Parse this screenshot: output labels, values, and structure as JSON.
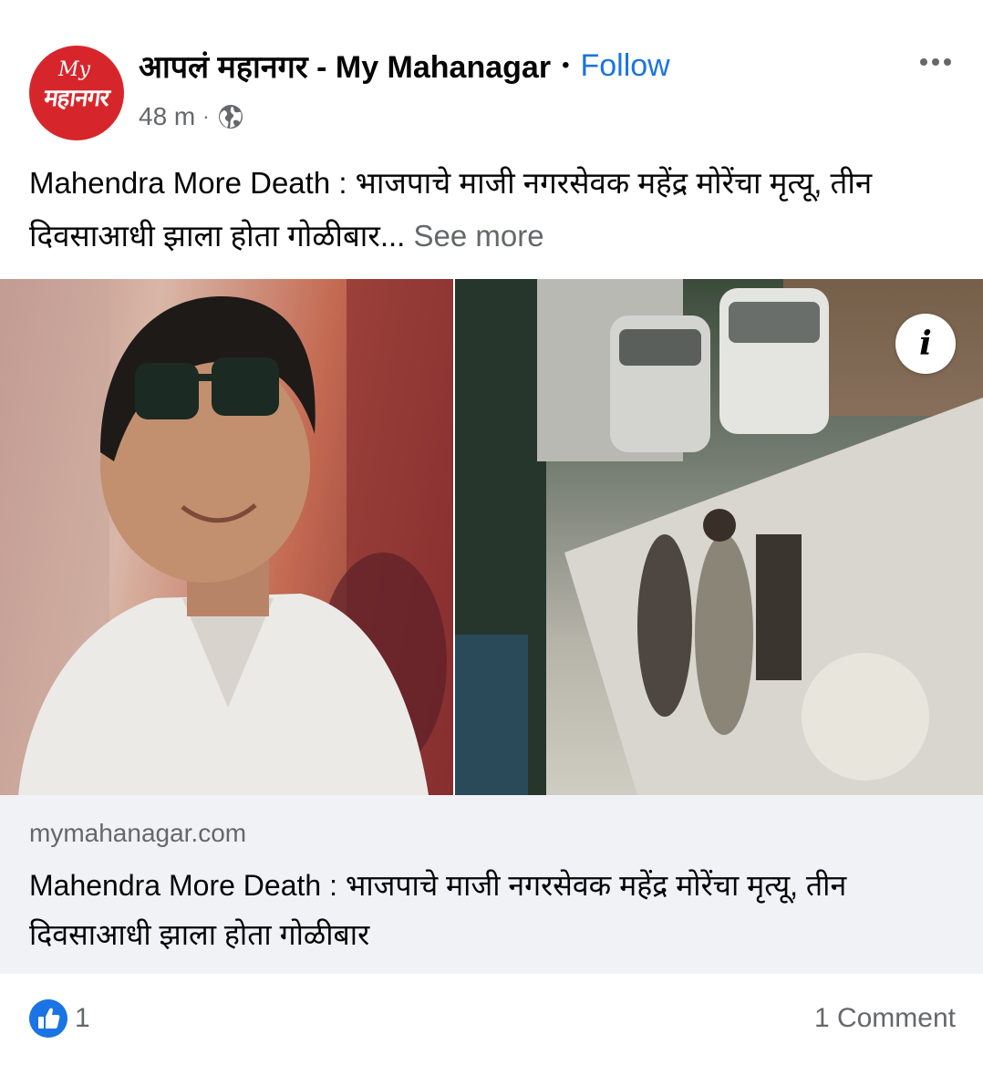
{
  "page": {
    "name": "आपलं महानगर - My Mahanagar",
    "follow_label": "Follow",
    "separator": "•",
    "avatar_logo_small": "My",
    "avatar_logo_main": "महानगर"
  },
  "meta": {
    "time": "48 m",
    "separator": "·",
    "privacy_icon": "globe-icon"
  },
  "post": {
    "caption": "Mahendra More Death : भाजपाचे माजी नगरसेवक महेंद्र मोरेंचा मृत्यू, तीन दिवसाआधी झाला होता गोळीबार...",
    "see_more": "See more"
  },
  "media": {
    "info_icon": "i"
  },
  "link_preview": {
    "domain": "mymahanagar.com",
    "title": "Mahendra More Death : भाजपाचे माजी नगरसेवक महेंद्र मोरेंचा मृत्यू, तीन दिवसाआधी झाला होता गोळीबार"
  },
  "footer": {
    "like_count": "1",
    "comments": "1 Comment"
  },
  "colors": {
    "accent": "#1b74e4",
    "brand_red": "#d7262b",
    "secondary_text": "#65676b",
    "link_bg": "#f0f2f5"
  }
}
